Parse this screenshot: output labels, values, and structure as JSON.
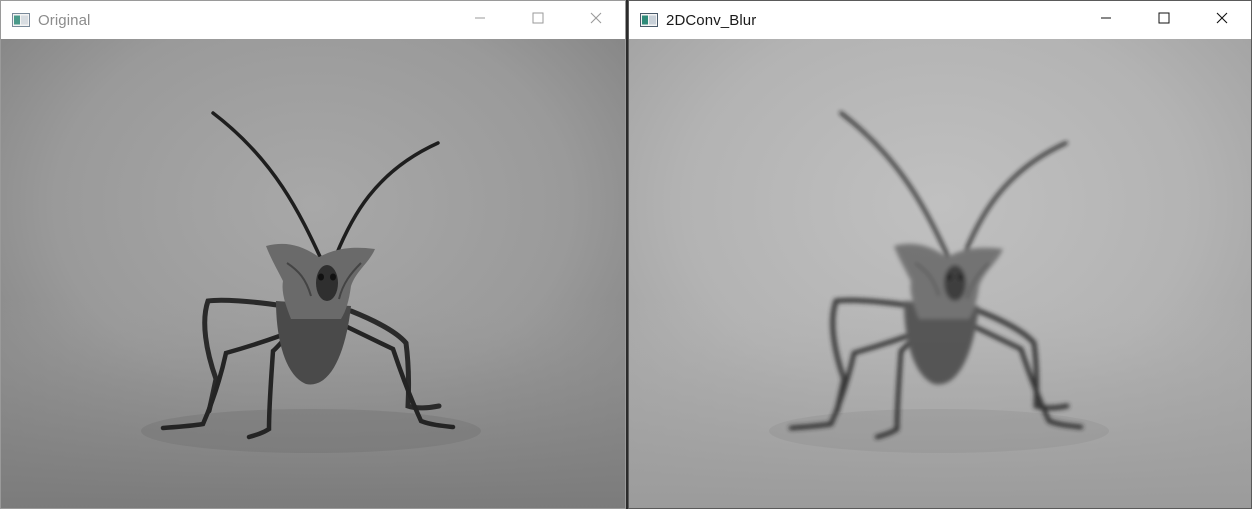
{
  "windows": [
    {
      "title": "Original",
      "active": false,
      "image": "grayscale photo of a leaf-footed bug facing camera with long antennae",
      "blurred": false
    },
    {
      "title": "2DConv_Blur",
      "active": true,
      "image": "blurred grayscale photo of a leaf-footed bug facing camera with long antennae",
      "blurred": true
    }
  ],
  "icons": {
    "app": "app-window-icon",
    "minimize": "minimize-icon",
    "maximize": "maximize-icon",
    "close": "close-icon"
  },
  "colors": {
    "inactive_title": "#8c8c8c",
    "active_title": "#1a1a1a",
    "titlebar_bg": "#ffffff"
  }
}
